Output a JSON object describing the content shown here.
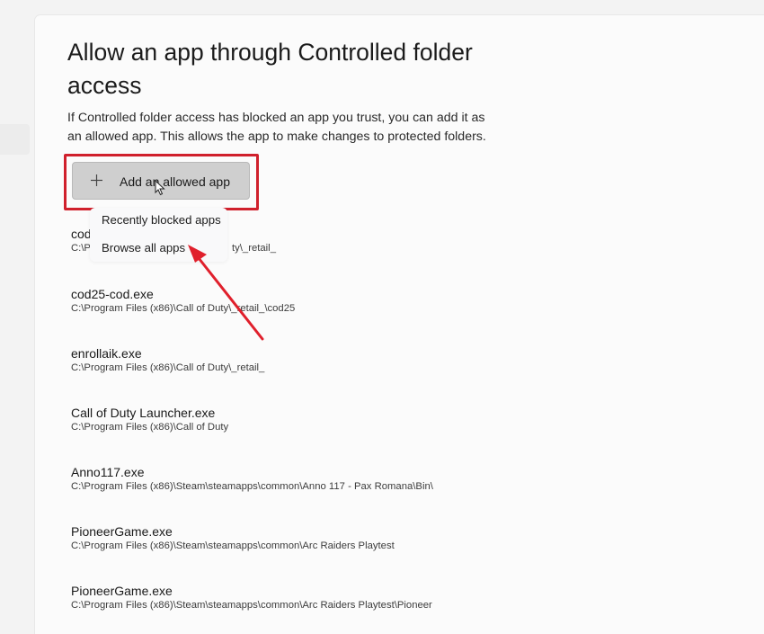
{
  "page": {
    "title": "Allow an app through Controlled folder access",
    "description": "If Controlled folder access has blocked an app you trust, you can add it as an allowed app. This allows the app to make changes to protected folders."
  },
  "add_button": {
    "label": "Add an allowed app",
    "icon": "plus-icon"
  },
  "dropdown": {
    "items": [
      {
        "label": "Recently blocked apps"
      },
      {
        "label": "Browse all apps"
      }
    ]
  },
  "apps": [
    {
      "name": "cod",
      "path": "C:\\P",
      "path_tail": "ty\\_retail_"
    },
    {
      "name": "cod25-cod.exe",
      "path": "C:\\Program Files (x86)\\Call of Duty\\_retail_\\cod25"
    },
    {
      "name": "enrollaik.exe",
      "path": "C:\\Program Files (x86)\\Call of Duty\\_retail_"
    },
    {
      "name": "Call of Duty Launcher.exe",
      "path": "C:\\Program Files (x86)\\Call of Duty"
    },
    {
      "name": "Anno117.exe",
      "path": "C:\\Program Files (x86)\\Steam\\steamapps\\common\\Anno 117 - Pax Romana\\Bin\\"
    },
    {
      "name": "PioneerGame.exe",
      "path": "C:\\Program Files (x86)\\Steam\\steamapps\\common\\Arc Raiders Playtest"
    },
    {
      "name": "PioneerGame.exe",
      "path": "C:\\Program Files (x86)\\Steam\\steamapps\\common\\Arc Raiders Playtest\\Pioneer"
    }
  ],
  "annotation": {
    "highlight_color": "#d0202c",
    "arrow_color": "#e0202c"
  }
}
